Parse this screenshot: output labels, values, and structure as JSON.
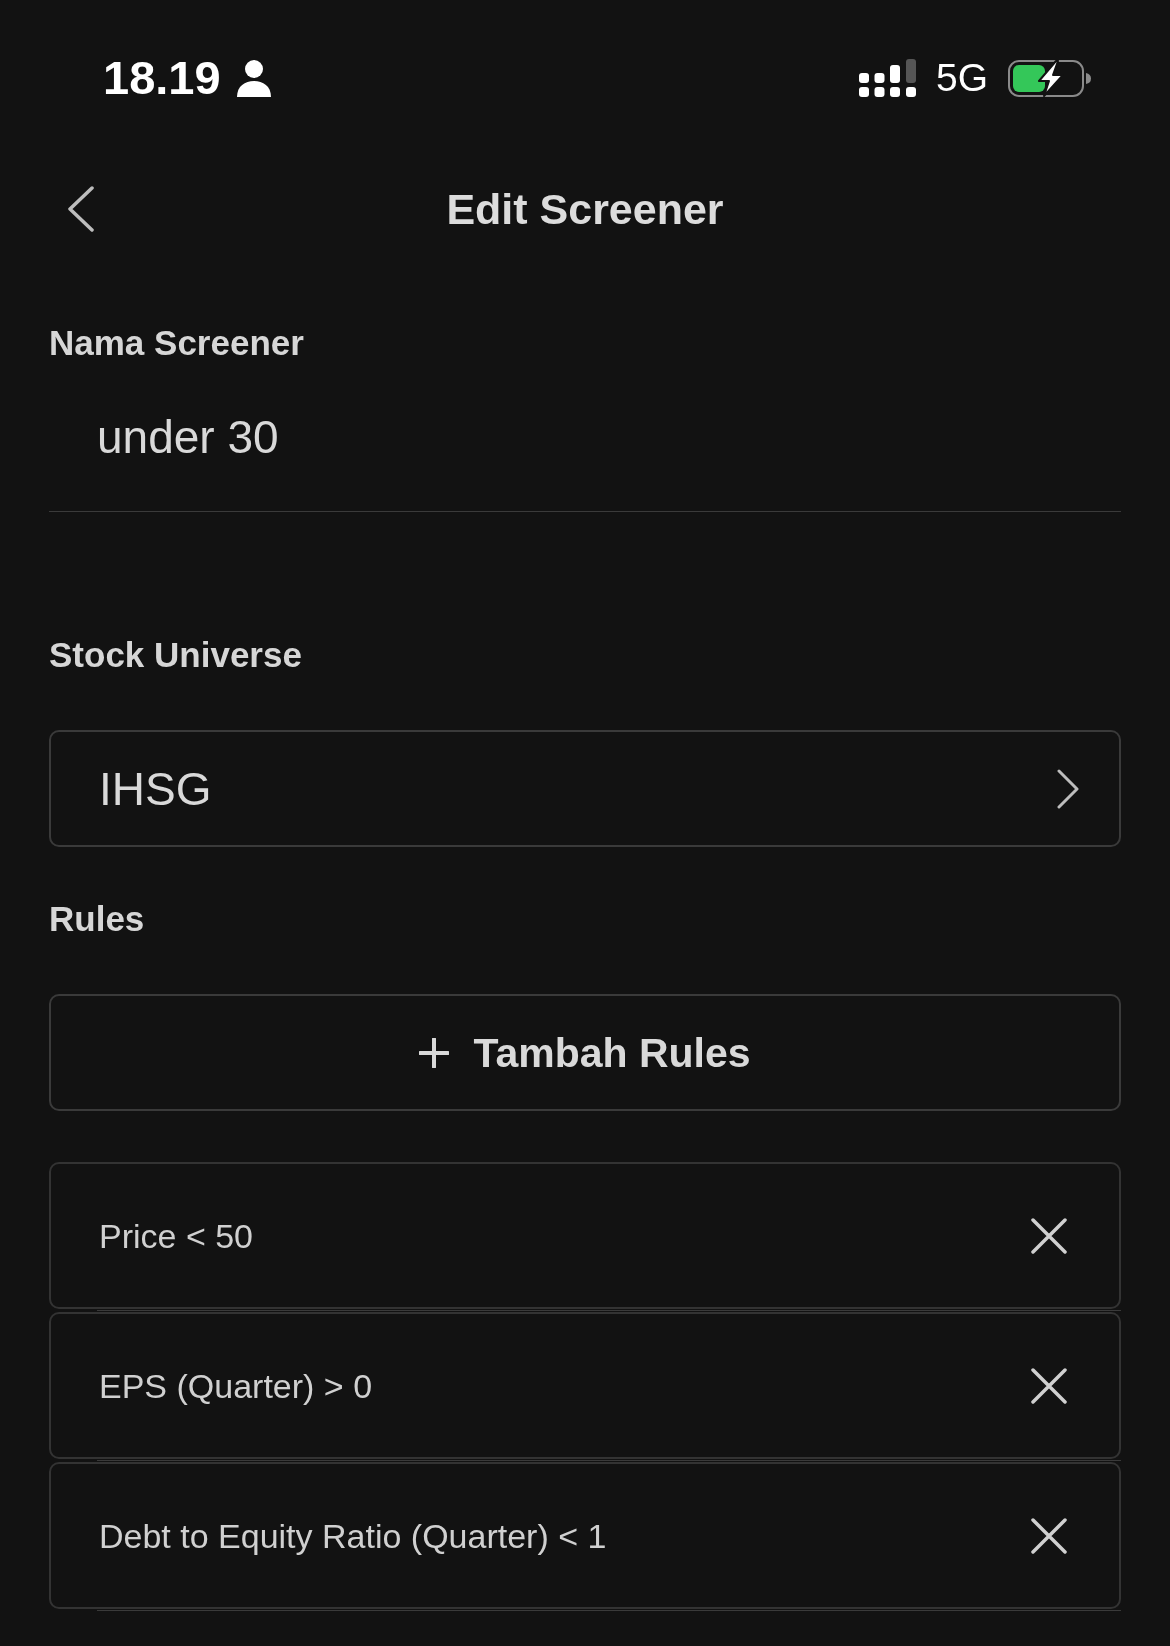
{
  "status_bar": {
    "time": "18.19",
    "network": "5G"
  },
  "header": {
    "title": "Edit Screener"
  },
  "name_field": {
    "label": "Nama Screener",
    "value": "under 30"
  },
  "stock_universe": {
    "label": "Stock Universe",
    "value": "IHSG"
  },
  "rules": {
    "label": "Rules",
    "add_button": "Tambah Rules",
    "items": [
      {
        "text": "Price < 50"
      },
      {
        "text": "EPS (Quarter) > 0"
      },
      {
        "text": "Debt to Equity Ratio (Quarter) < 1"
      }
    ]
  }
}
